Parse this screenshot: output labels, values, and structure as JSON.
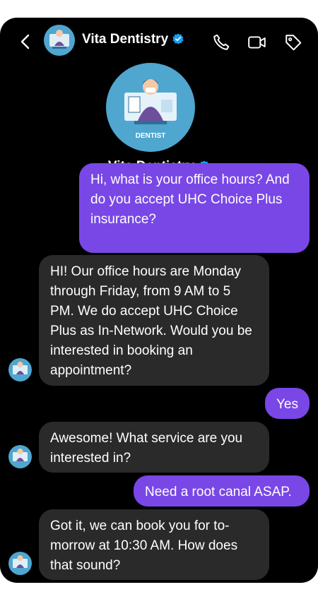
{
  "header": {
    "contact_name": "Vita Dentistry",
    "back_icon": "chevron-left-icon",
    "call_icon": "phone-icon",
    "video_icon": "video-camera-icon",
    "tag_icon": "tag-icon",
    "verified_color": "#1d9bf0"
  },
  "profile": {
    "name": "Vita Dentistry",
    "avatar_label": "DENTIST"
  },
  "colors": {
    "outgoing_bubble": "#7947e6",
    "incoming_bubble": "#2a2a2a",
    "background": "#000000"
  },
  "messages": [
    {
      "sender": "user",
      "text": "Hi, what is your office hours? And do you accept UHC Choice Plus insurance?"
    },
    {
      "sender": "business",
      "text": "HI! Our office hours are Monday through Friday, from 9 AM to 5 PM. We do accept UHC Choice Plus as In-Network. Would you be interested in booking an appointment?"
    },
    {
      "sender": "user",
      "text": "Yes"
    },
    {
      "sender": "business",
      "text": "Awesome! What service are you interested in?"
    },
    {
      "sender": "user",
      "text": "Need a root canal ASAP."
    },
    {
      "sender": "business",
      "text": "Got it, we can book you for to-morrow at 10:30 AM. How does that sound?"
    }
  ]
}
